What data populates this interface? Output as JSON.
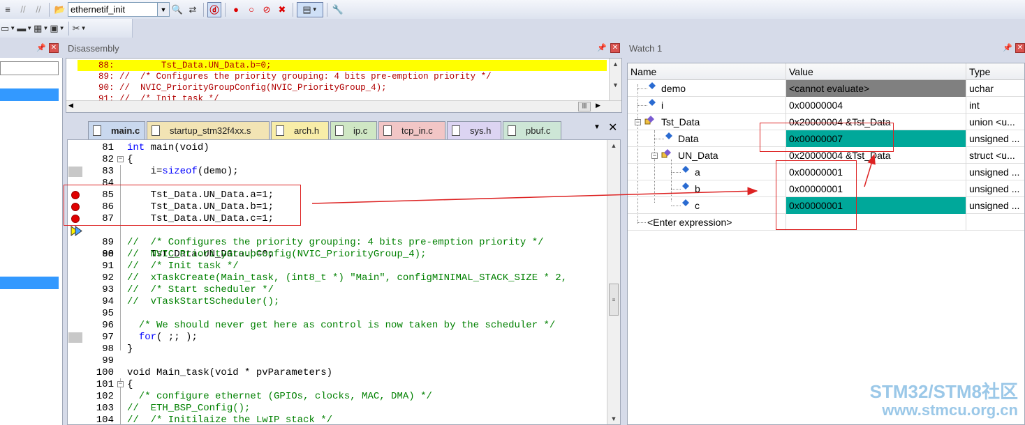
{
  "toolbar": {
    "target_combo": "ethernetif_init"
  },
  "panes": {
    "disassembly_title": "Disassembly",
    "watch_title": "Watch 1"
  },
  "disassembly": {
    "lines": [
      "    88:         Tst_Data.UN_Data.b=0;",
      "    89: //  /* Configures the priority grouping: 4 bits pre-emption priority */",
      "    90: //  NVIC_PriorityGroupConfig(NVIC_PriorityGroup_4);",
      "    91: //  /* Init task */"
    ]
  },
  "tabs": [
    {
      "label": "main.c",
      "active": true,
      "color": "#c9d8ee"
    },
    {
      "label": "startup_stm32f4xx.s",
      "active": false,
      "color": "#f2e4b4"
    },
    {
      "label": "arch.h",
      "active": false,
      "color": "#f8eda8"
    },
    {
      "label": "ip.c",
      "active": false,
      "color": "#cfe7c4"
    },
    {
      "label": "tcp_in.c",
      "active": false,
      "color": "#f2c6c6"
    },
    {
      "label": "sys.h",
      "active": false,
      "color": "#dcd4f2"
    },
    {
      "label": "pbuf.c",
      "active": false,
      "color": "#cde6d6"
    }
  ],
  "code": {
    "lines": [
      {
        "n": "81",
        "text": "int main(void)"
      },
      {
        "n": "82",
        "text": "{"
      },
      {
        "n": "83",
        "text": "    i=sizeof(demo);"
      },
      {
        "n": "84",
        "text": ""
      },
      {
        "n": "85",
        "text": "    Tst_Data.UN_Data.a=1;"
      },
      {
        "n": "86",
        "text": "    Tst_Data.UN_Data.b=1;"
      },
      {
        "n": "87",
        "text": "    Tst_Data.UN_Data.c=1;"
      },
      {
        "n": "88",
        "text": "    Tst_Data.UN_Data.b=0;"
      },
      {
        "n": "89",
        "text": "//  /* Configures the priority grouping: 4 bits pre-emption priority */"
      },
      {
        "n": "90",
        "text": "//  NVIC_PriorityGroupConfig(NVIC_PriorityGroup_4);"
      },
      {
        "n": "91",
        "text": "//  /* Init task */"
      },
      {
        "n": "92",
        "text": "//  xTaskCreate(Main_task, (int8_t *) \"Main\", configMINIMAL_STACK_SIZE * 2,"
      },
      {
        "n": "93",
        "text": "//  /* Start scheduler */"
      },
      {
        "n": "94",
        "text": "//  vTaskStartScheduler();"
      },
      {
        "n": "95",
        "text": ""
      },
      {
        "n": "96",
        "text": "  /* We should never get here as control is now taken by the scheduler */"
      },
      {
        "n": "97",
        "text": "  for( ;; );"
      },
      {
        "n": "98",
        "text": "}"
      },
      {
        "n": "99",
        "text": ""
      },
      {
        "n": "100",
        "text": "void Main_task(void * pvParameters)"
      },
      {
        "n": "101",
        "text": "{"
      },
      {
        "n": "102",
        "text": "  /* configure ethernet (GPIOs, clocks, MAC, DMA) */"
      },
      {
        "n": "103",
        "text": "//  ETH_BSP_Config();"
      },
      {
        "n": "104",
        "text": "//  /* Initilaize the LwIP stack */"
      }
    ]
  },
  "watch": {
    "headers": {
      "name": "Name",
      "value": "Value",
      "type": "Type"
    },
    "rows": [
      {
        "name": "demo",
        "value": "<cannot evaluate>",
        "type": "uchar"
      },
      {
        "name": "i",
        "value": "0x00000004",
        "type": "int"
      },
      {
        "name": "Tst_Data",
        "value": "0x20000004 &Tst_Data",
        "type": "union <u..."
      },
      {
        "name": "Data",
        "value": "0x00000007",
        "type": "unsigned ..."
      },
      {
        "name": "UN_Data",
        "value": "0x20000004 &Tst_Data",
        "type": "struct <u..."
      },
      {
        "name": "a",
        "value": "0x00000001",
        "type": "unsigned ..."
      },
      {
        "name": "b",
        "value": "0x00000001",
        "type": "unsigned ..."
      },
      {
        "name": "c",
        "value": "0x00000001",
        "type": "unsigned ..."
      },
      {
        "name": "<Enter expression>",
        "value": "",
        "type": ""
      }
    ]
  },
  "watermark": {
    "line1": "STM32/STM8社区",
    "line2": "www.stmcu.org.cn"
  },
  "colors": {
    "exec_highlight": "#ffff00",
    "changed_value": "#00a89a",
    "breakpoint": "#e00000",
    "annotation": "#d22222"
  }
}
